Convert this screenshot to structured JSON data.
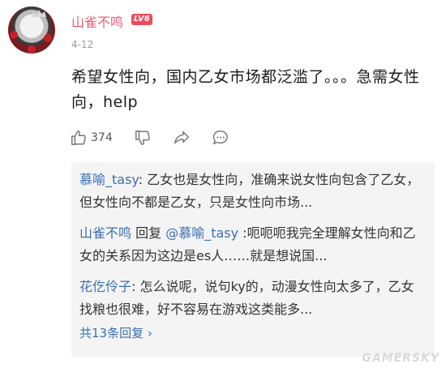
{
  "comment": {
    "username": "山雀不鸣",
    "level_badge": "LV6",
    "date": "4-12",
    "text": "希望女性向，国内乙女市场都泛滥了。。。急需女性向，help",
    "like_count": "374"
  },
  "replies": [
    {
      "name": "慕喻_tasy",
      "separator": ": ",
      "text": "乙女也是女性向，准确来说女性向包含了乙女，但女性向不都是乙女，只是女性向市场..."
    },
    {
      "name": "山雀不鸣",
      "reply_word": " 回复 ",
      "target": "@慕喻_tasy",
      "separator": " :",
      "text": "呃呃呃我完全理解女性向和乙女的关系因为这边是es人……就是想说国..."
    },
    {
      "name": "花仡伶子",
      "separator": ": ",
      "text": "怎么说呢，说句ky的，动漫女性向太多了，乙女找粮也很难，好不容易在游戏这类能多..."
    }
  ],
  "more_replies_label": "共13条回复 ›",
  "watermark": "GAMERSKY",
  "icons": [
    "avatar",
    "thumb-up-icon",
    "thumb-down-icon",
    "share-icon",
    "comment-icon"
  ],
  "colors": {
    "username": "#e85d75",
    "level_badge": "#f04b58",
    "reply_name": "#3a6fb0"
  }
}
